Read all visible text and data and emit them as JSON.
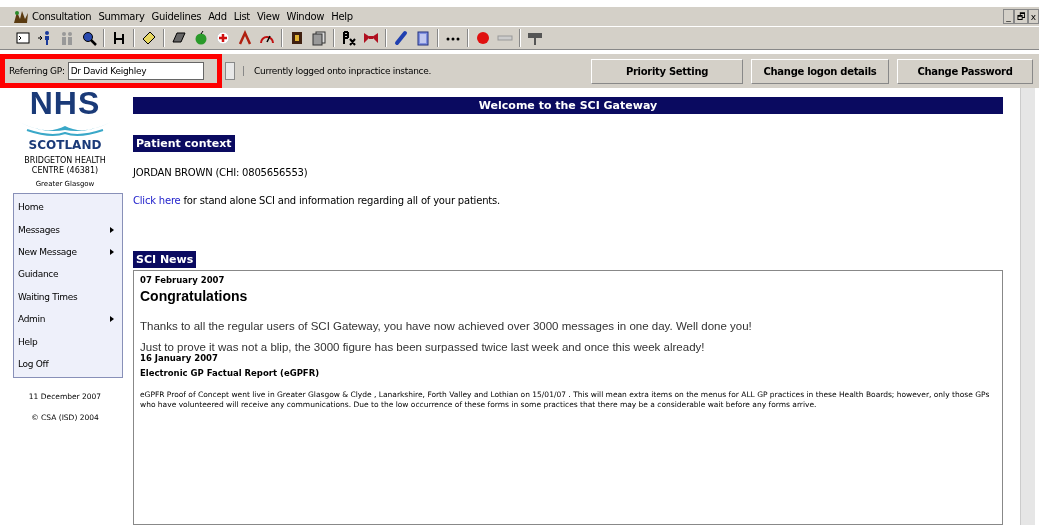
{
  "menu_bar": {
    "items": [
      "Consultation",
      "Summary",
      "Guidelines",
      "Add",
      "List",
      "View",
      "Window",
      "Help"
    ],
    "window_controls": [
      "_",
      "🗗",
      "x"
    ]
  },
  "gp_bar": {
    "label": "Referring GP:",
    "value": "Dr David Keighley",
    "status": "Currently logged onto inpractice instance.",
    "buttons": [
      "Priority Setting",
      "Change logon details",
      "Change Password"
    ]
  },
  "sidebar": {
    "logo_top": "NHS",
    "logo_bottom": "SCOTLAND",
    "practice": "BRIDGETON HEALTH CENTRE (46381)",
    "region": "Greater Glasgow",
    "items": [
      {
        "label": "Home",
        "submenu": false
      },
      {
        "label": "Messages",
        "submenu": true
      },
      {
        "label": "New Message",
        "submenu": true
      },
      {
        "label": "Guidance",
        "submenu": false
      },
      {
        "label": "Waiting Times",
        "submenu": false
      },
      {
        "label": "Admin",
        "submenu": true
      },
      {
        "label": "Help",
        "submenu": false
      },
      {
        "label": "Log Off",
        "submenu": false
      }
    ],
    "date": "11 December 2007",
    "copyright": "© CSA (ISD) 2004"
  },
  "main": {
    "title": "Welcome to the SCI Gateway",
    "patient_heading": "Patient context",
    "patient": "JORDAN BROWN (CHI: 0805656553)",
    "link": "Click here",
    "link_text": " for stand alone SCI and information regarding all of your patients.",
    "news_heading": "SCI News",
    "news": [
      {
        "kind": "headline",
        "date": "07 February 2007",
        "title": "Congratulations",
        "paragraphs": [
          "Thanks to all the regular users of SCI Gateway, you have now achieved over 3000 messages in one day. Well done you!",
          "Just to prove it was not a blip, the 3000 figure has been surpassed twice last week and once this week already!"
        ]
      },
      {
        "kind": "notice",
        "date": "16 January 2007",
        "title": "Electronic GP Factual Report (eGPFR)",
        "paragraphs": [
          "eGPFR Proof of Concept went live in Greater Glasgow & Clyde , Lanarkshire, Forth Valley and Lothian on 15/01/07 . This will mean extra items on the menus for ALL GP practices in these Health Boards; however, only those GPs who have volunteered will receive any communications. Due to the low occurrence of these forms in some practices that there may be a considerable wait before any forms arrive."
        ]
      }
    ]
  }
}
